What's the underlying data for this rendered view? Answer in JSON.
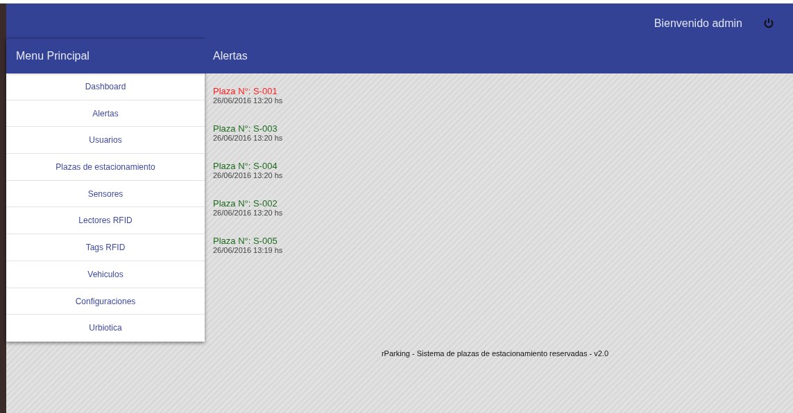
{
  "header": {
    "welcome": "Bienvenido admin"
  },
  "sidebar": {
    "title": "Menu Principal",
    "items": [
      "Dashboard",
      "Alertas",
      "Usuarios",
      "Plazas de estacionamiento",
      "Sensores",
      "Lectores RFID",
      "Tags RFID",
      "Vehiculos",
      "Configuraciones",
      "Urbiotica"
    ]
  },
  "content": {
    "title": "Alertas",
    "alerts": [
      {
        "title": "Plaza N°: S-001",
        "time": "26/06/2016 13:20 hs",
        "color": "#ff2020"
      },
      {
        "title": "Plaza N°: S-003",
        "time": "26/06/2016 13:20 hs",
        "color": "#1e6b1e"
      },
      {
        "title": "Plaza N°: S-004",
        "time": "26/06/2016 13:20 hs",
        "color": "#1e6b1e"
      },
      {
        "title": "Plaza N°: S-002",
        "time": "26/06/2016 13:20 hs",
        "color": "#1e6b1e"
      },
      {
        "title": "Plaza N°: S-005",
        "time": "26/06/2016 13:19 hs",
        "color": "#1e6b1e"
      }
    ]
  },
  "footer": "rParking - Sistema de plazas de estacionamiento reservadas - v2.0"
}
